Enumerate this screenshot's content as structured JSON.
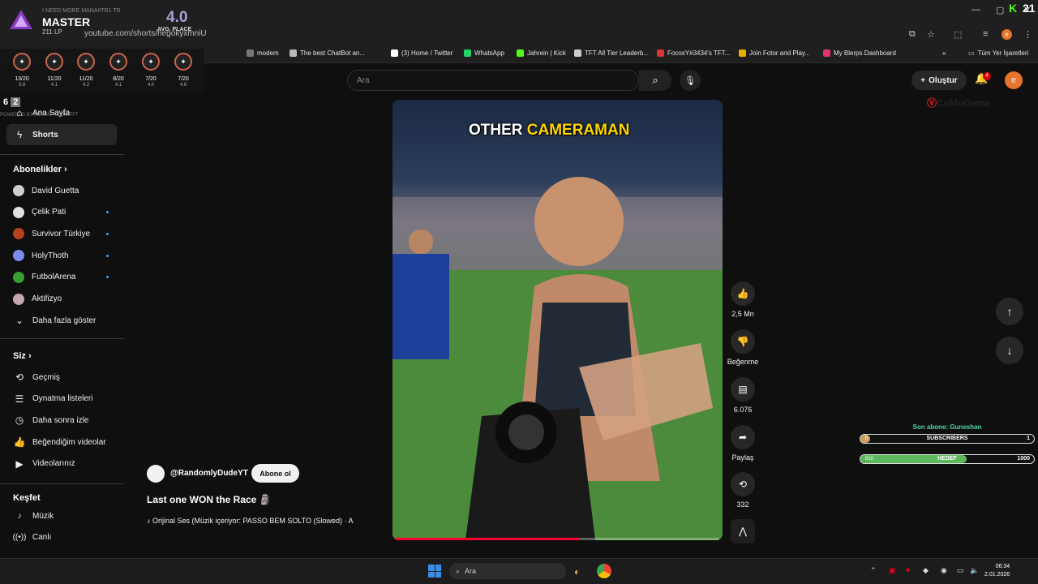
{
  "browser": {
    "url": "youtube.com/shorts/hegokyxmniU",
    "bookmarks": [
      {
        "label": "modem",
        "color": "#777"
      },
      {
        "label": "The best ChatBot an...",
        "color": "#bbb"
      },
      {
        "label": "(3) Home / Twitter",
        "color": "#fff"
      },
      {
        "label": "WhatsApp",
        "color": "#25d366"
      },
      {
        "label": "Jahrein | Kick",
        "color": "#53fc18"
      },
      {
        "label": "TFT All Tier Leaderb...",
        "color": "#ccc"
      },
      {
        "label": "FocosY#3434's TFT...",
        "color": "#d33"
      },
      {
        "label": "Join Fotor and Play...",
        "color": "#e8b000"
      },
      {
        "label": "My Blerps Dashboard",
        "color": "#e0336a"
      }
    ],
    "all_bookmarks": "Tüm Yer İşaretleri"
  },
  "overlay": {
    "need": "I NEED MORE MANA#TR1 TR",
    "rank": "MASTER",
    "lp": "211 LP",
    "avg": "4.0",
    "avg_label": "AVG. PLACE",
    "stats": [
      {
        "a": "13/20",
        "b": "3.8"
      },
      {
        "a": "11/20",
        "b": "4.1"
      },
      {
        "a": "11/20",
        "b": "4.2"
      },
      {
        "a": "8/20",
        "b": "4.1"
      },
      {
        "a": "7/20",
        "b": "4.0"
      },
      {
        "a": "7/20",
        "b": "4.6"
      }
    ],
    "bottom_left": "6",
    "bottom_right": "2",
    "powered": "POWERED BY METATFT.COM/TFT",
    "corner_score": "21"
  },
  "sidebar": {
    "home": "Ana Sayfa",
    "shorts": "Shorts",
    "subs_title": "Abonelikler",
    "subs": [
      {
        "label": "David Guetta",
        "color": "#cfcfcf",
        "dot": false
      },
      {
        "label": "Çelik Pati",
        "color": "#e0e0e0",
        "dot": true
      },
      {
        "label": "Survivor Türkiye",
        "color": "#b5421c",
        "dot": true
      },
      {
        "label": "HolyThoth",
        "color": "#7b8cf0",
        "dot": true
      },
      {
        "label": "FutbolArena",
        "color": "#3a9e2f",
        "dot": true
      },
      {
        "label": "Aktifizyo",
        "color": "#c4a6b0",
        "dot": false
      }
    ],
    "more": "Daha fazla göster",
    "you_title": "Siz",
    "you_items": [
      "Geçmiş",
      "Oynatma listeleri",
      "Daha sonra izle",
      "Beğendiğim videolar",
      "Videolarınız"
    ],
    "explore_title": "Keşfet",
    "explore_items": [
      "Müzik",
      "Canlı"
    ]
  },
  "header": {
    "search_placeholder": "Ara",
    "create": "Oluştur",
    "notif_count": "4",
    "avatar_letter": "e"
  },
  "video": {
    "caption_white": "OTHER ",
    "caption_yellow": "CAMERAMAN",
    "progress": 0.57,
    "channel": "@RandomlyDudeYT",
    "subscribe": "Abone ol",
    "title": "Last one WON the Race 🗿",
    "audio": "♪ Orijinal Ses (Müzik içeriyor: PASSO BEM SOLTO (Slowed) · A"
  },
  "actions": {
    "likes": "2,5 Mn",
    "dislike": "Beğenme",
    "comments": "6.076",
    "share": "Paylaş",
    "remix": "332"
  },
  "widget": {
    "last_sub": "Son abone: Guneshan",
    "subs_label": "SUBSCRIBERS",
    "subs_left": "0",
    "subs_right": "1",
    "goal_label": "HEDEF",
    "goal_left": "610",
    "goal_right": "1000",
    "goal_progress": 0.61
  },
  "taskbar": {
    "search": "Ara",
    "time": "06:34",
    "date": "2.01.2026"
  }
}
